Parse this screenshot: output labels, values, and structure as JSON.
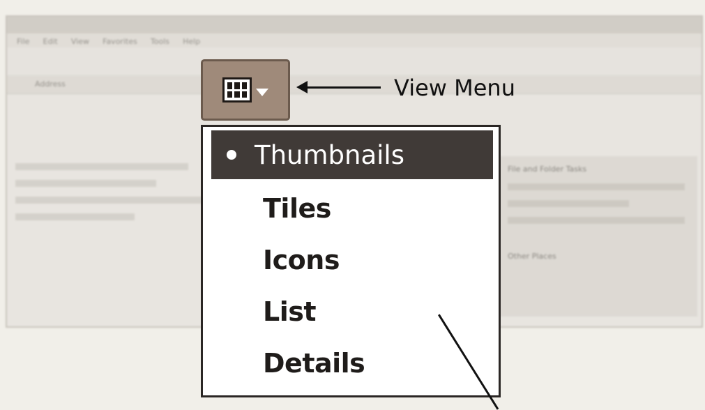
{
  "background_window": {
    "menu": [
      "File",
      "Edit",
      "View",
      "Favorites",
      "Tools",
      "Help"
    ],
    "address_label": "Address",
    "pane_heading": "File and Folder Tasks",
    "other_places": "Other Places"
  },
  "annotation": {
    "label": "View Menu"
  },
  "view_menu": {
    "items": [
      {
        "label": "Thumbnails",
        "selected": true
      },
      {
        "label": "Tiles",
        "selected": false
      },
      {
        "label": "Icons",
        "selected": false
      },
      {
        "label": "List",
        "selected": false
      },
      {
        "label": "Details",
        "selected": false
      }
    ]
  },
  "colors": {
    "selected_bg": "#403a37",
    "button_bg": "#9f8a7a",
    "menu_border": "#2a2624"
  },
  "icons": {
    "view_button": "grid-thumbnails-icon",
    "dropdown": "chevron-down-icon"
  }
}
